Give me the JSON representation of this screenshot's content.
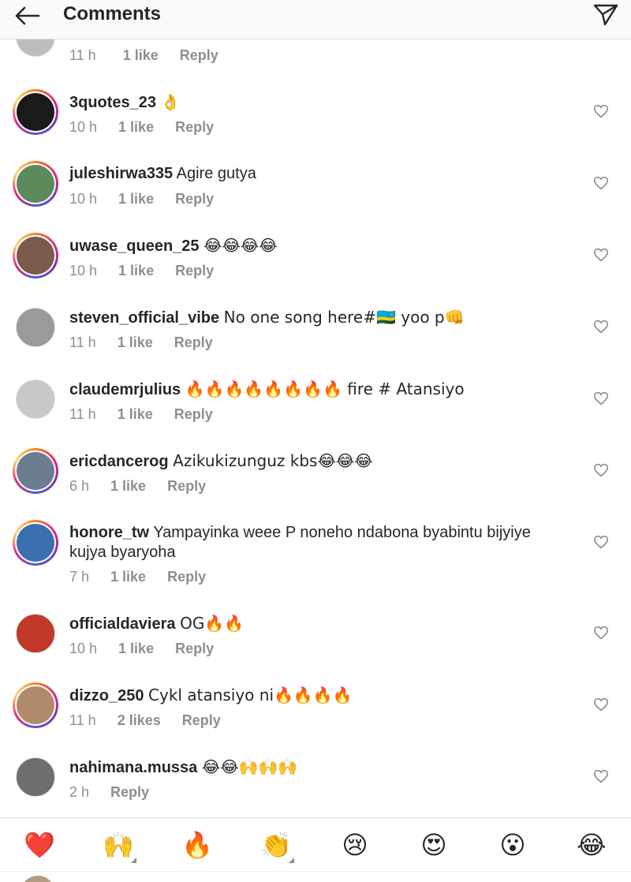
{
  "header": {
    "title": "Comments"
  },
  "partial_comment": {
    "time": "11 h",
    "likes": "1 like",
    "reply": "Reply"
  },
  "comments": [
    {
      "username": "3quotes_23",
      "text": "👌",
      "time": "10 h",
      "likes": "1 like",
      "reply": "Reply",
      "avatar_color": "#1a1a1a",
      "ring": true
    },
    {
      "username": "juleshirwa335",
      "text": "Agire gutya",
      "time": "10 h",
      "likes": "1 like",
      "reply": "Reply",
      "avatar_color": "#5d8a5a",
      "ring": true
    },
    {
      "username": "uwase_queen_25",
      "text": "😂😂😂😂",
      "time": "10 h",
      "likes": "1 like",
      "reply": "Reply",
      "avatar_color": "#7a5a4a",
      "ring": true
    },
    {
      "username": "steven_official_vibe",
      "text": "No one song here#🇷🇼 yoo p👊",
      "time": "11 h",
      "likes": "1 like",
      "reply": "Reply",
      "avatar_color": "#9a9a9a",
      "ring": false
    },
    {
      "username": "claudemrjulius",
      "text": "🔥🔥🔥🔥🔥🔥🔥🔥 fire # Atansiyo",
      "time": "11 h",
      "likes": "1 like",
      "reply": "Reply",
      "avatar_color": "#c8c8c8",
      "ring": false
    },
    {
      "username": "ericdancerog",
      "text": "Azikukizunguz kbs😂😂😂",
      "time": "6 h",
      "likes": "1 like",
      "reply": "Reply",
      "avatar_color": "#6b7d8f",
      "ring": true
    },
    {
      "username": "honore_tw",
      "text": "Yampayinka weee P noneho ndabona byabintu bijyiye kujya byaryoha",
      "time": "7 h",
      "likes": "1 like",
      "reply": "Reply",
      "avatar_color": "#3a6fb0",
      "ring": true
    },
    {
      "username": "officialdaviera",
      "text": "OG🔥🔥",
      "time": "10 h",
      "likes": "1 like",
      "reply": "Reply",
      "avatar_color": "#c0392b",
      "ring": false
    },
    {
      "username": "dizzo_250",
      "text": "Cykl atansiyo ni🔥🔥🔥🔥",
      "time": "11 h",
      "likes": "2 likes",
      "reply": "Reply",
      "avatar_color": "#b08a6a",
      "ring": true
    },
    {
      "username": "nahimana.mussa",
      "text": "😂😂🙌🙌🙌",
      "time": "2 h",
      "likes": "",
      "reply": "Reply",
      "avatar_color": "#6e6e6e",
      "ring": false
    }
  ],
  "emoji_bar": [
    "❤️",
    "🙌",
    "🔥",
    "👏",
    "😢",
    "😍",
    "😮",
    "😂"
  ],
  "colors": {
    "text": "#262626",
    "meta": "#8e8e8e",
    "divider": "#dbdbdb",
    "heart_red": "#ed4956"
  }
}
